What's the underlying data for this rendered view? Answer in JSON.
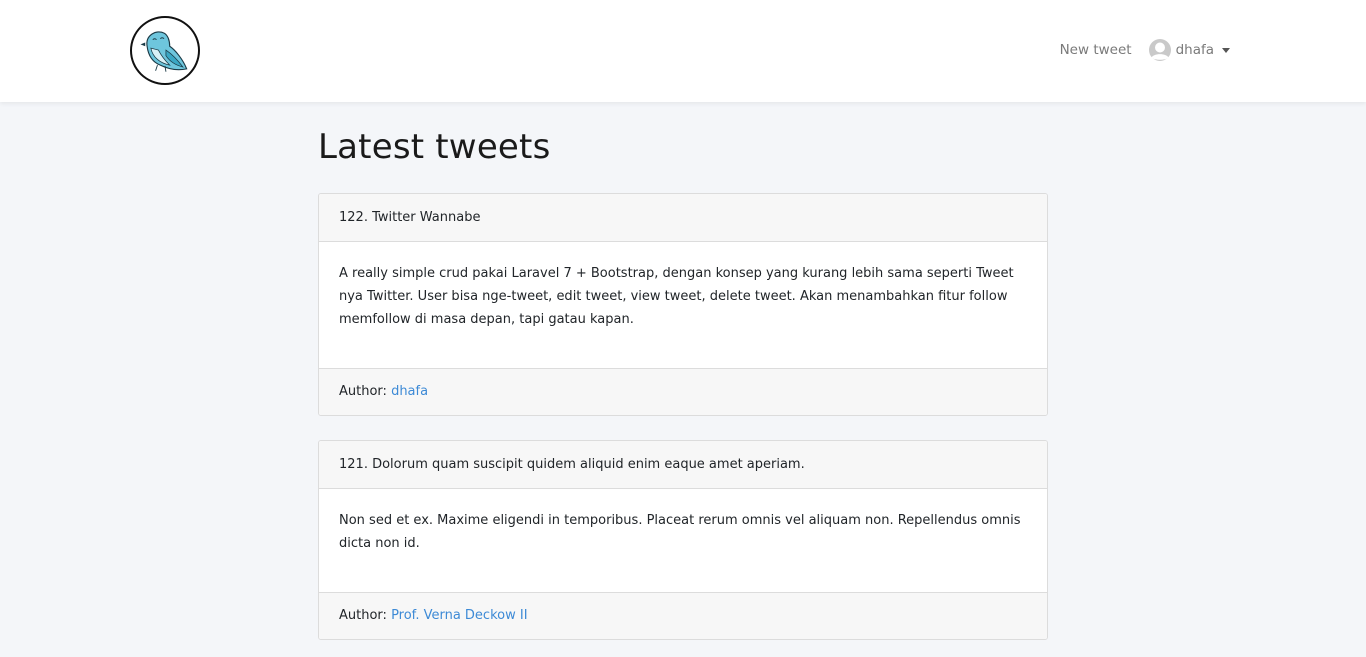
{
  "navbar": {
    "new_tweet_label": "New tweet",
    "username": "dhafa"
  },
  "page_title": "Latest tweets",
  "tweets": [
    {
      "header": "122. Twitter Wannabe",
      "body": "A really simple crud pakai Laravel 7 + Bootstrap, dengan konsep yang kurang lebih sama seperti Tweet nya Twitter. User bisa nge-tweet, edit tweet, view tweet, delete tweet. Akan menambahkan fitur follow memfollow di masa depan, tapi gatau kapan.",
      "author_label": "Author:",
      "author": "dhafa"
    },
    {
      "header": "121. Dolorum quam suscipit quidem aliquid enim eaque amet aperiam.",
      "body": "Non sed et ex. Maxime eligendi in temporibus. Placeat rerum omnis vel aliquam non. Repellendus omnis dicta non id.",
      "author_label": "Author:",
      "author": "Prof. Verna Deckow II"
    }
  ],
  "colors": {
    "link": "#3d8ad6",
    "background": "#f4f6f9",
    "bird": "#5bbfd6"
  },
  "icons": {
    "logo": "bird-logo-icon",
    "avatar": "user-avatar-icon",
    "caret": "caret-down-icon"
  }
}
